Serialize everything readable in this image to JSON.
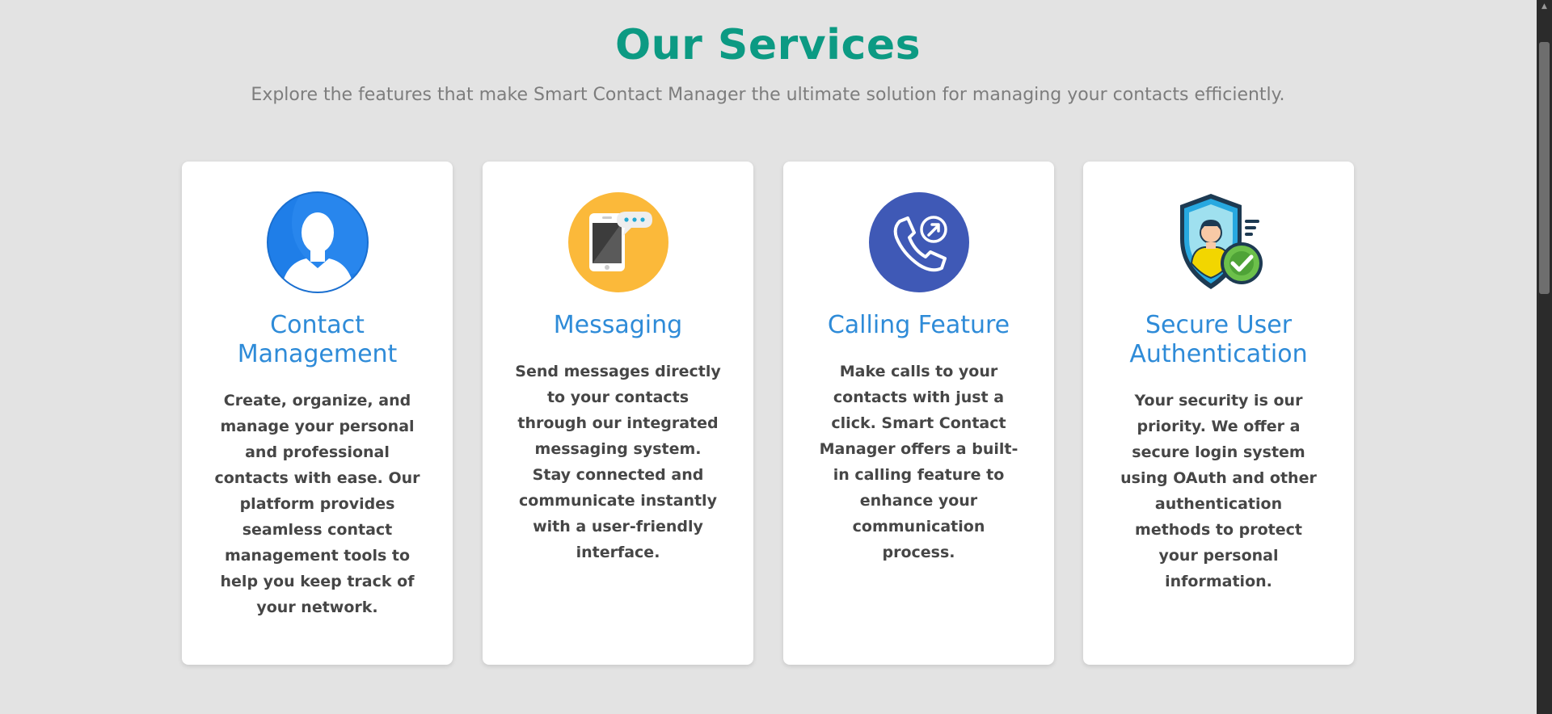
{
  "section": {
    "title": "Our Services",
    "subtitle": "Explore the features that make Smart Contact Manager the ultimate solution for managing your contacts efficiently."
  },
  "cards": [
    {
      "icon": "user-avatar-icon",
      "title": "Contact Management",
      "text": "Create, organize, and manage your personal and professional contacts with ease. Our platform provides seamless contact management tools to help you keep track of your network."
    },
    {
      "icon": "smartphone-message-icon",
      "title": "Messaging",
      "text": "Send messages directly to your contacts through our integrated messaging system. Stay connected and communicate instantly with a user-friendly interface."
    },
    {
      "icon": "phone-call-icon",
      "title": "Calling Feature",
      "text": "Make calls to your contacts with just a click. Smart Contact Manager offers a built-in calling feature to enhance your communication process."
    },
    {
      "icon": "secure-user-shield-icon",
      "title": "Secure User Authentication",
      "text": "Your security is our priority. We offer a secure login system using OAuth and other authentication methods to protect your personal information."
    }
  ],
  "colors": {
    "background": "#e3e3e3",
    "title": "#0c9a83",
    "card_title": "#2e8bd8",
    "card_text": "#464646",
    "subtitle": "#7d7d7d"
  }
}
